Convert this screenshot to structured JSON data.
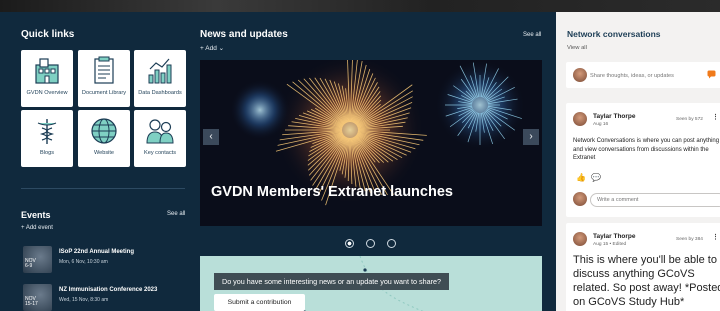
{
  "quick_links": {
    "title": "Quick links",
    "tiles": [
      {
        "label": "GVDN Overview",
        "icon": "building-icon"
      },
      {
        "label": "Document Library",
        "icon": "document-icon"
      },
      {
        "label": "Data Dashboards",
        "icon": "chart-icon"
      },
      {
        "label": "Blogs",
        "icon": "caduceus-icon"
      },
      {
        "label": "Website",
        "icon": "globe-icon"
      },
      {
        "label": "Key contacts",
        "icon": "people-icon"
      }
    ]
  },
  "events": {
    "title": "Events",
    "see_all": "See all",
    "add": "+  Add event",
    "items": [
      {
        "month": "NOV",
        "days": "6-9",
        "name": "ISoP 22nd Annual Meeting",
        "when": "Mon, 6 Nov, 10:30 am"
      },
      {
        "month": "NOV",
        "days": "15-17",
        "name": "NZ Immunisation Conference 2023",
        "when": "Wed, 15 Nov, 8:30 am"
      }
    ]
  },
  "news": {
    "title": "News and updates",
    "add": "+  Add ⌄",
    "see_all": "See all",
    "hero_caption": "GVDN Members' Extranet launches",
    "prev": "‹",
    "next": "›",
    "share_banner": "Do you have some interesting news or an update you want to share?",
    "share_button": "Submit a contribution"
  },
  "conversations": {
    "title": "Network conversations",
    "view_all": "View all",
    "compose_placeholder": "Share thoughts, ideas, or updates",
    "posts": [
      {
        "author": "Taylar Thorpe",
        "date": "Aug 16",
        "seen": "Seen by 572",
        "body": "Network Conversations is where you can post anything and view conversations from discussions within the Extranet",
        "comment_placeholder": "Write a comment"
      },
      {
        "author": "Taylar Thorpe",
        "date": "Aug 15  •  Edited",
        "seen": "Seen by 384",
        "body": "This is where you'll be able to discuss anything GCoVS related. So post away! *Posted on GCoVS Study Hub*"
      }
    ]
  },
  "colors": {
    "background": "#10293d",
    "share_card": "#b9dfd9",
    "panel": "#f3f2f1",
    "accent_orange": "#f07a1a"
  }
}
